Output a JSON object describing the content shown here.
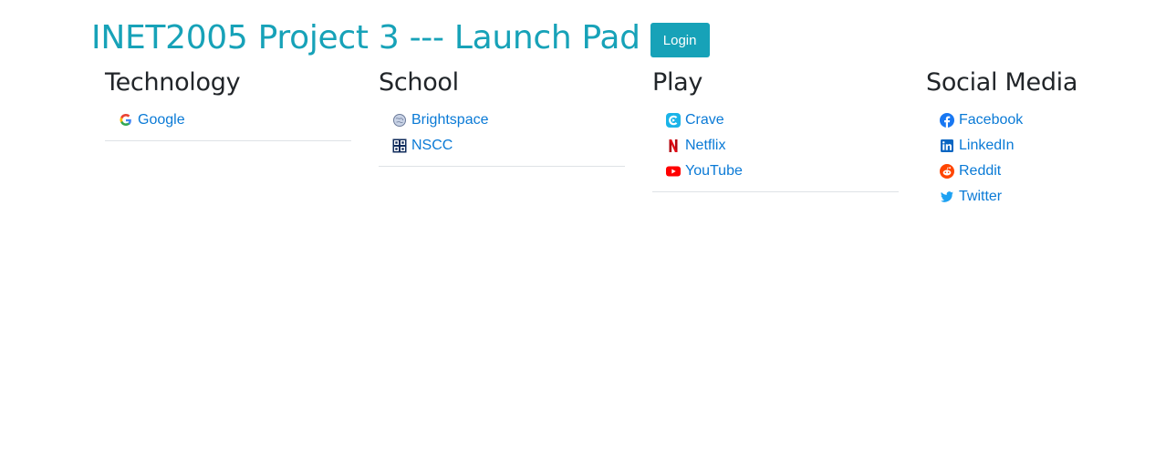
{
  "header": {
    "title": "INET2005 Project 3 --- Launch Pad",
    "login_label": "Login"
  },
  "colors": {
    "accent": "#17a2b8",
    "link": "#0a7ad6",
    "heading": "#212529",
    "divider": "#dee2e6"
  },
  "categories": [
    {
      "title": "Technology",
      "links": [
        {
          "label": "Google",
          "icon": "google-icon"
        }
      ]
    },
    {
      "title": "School",
      "links": [
        {
          "label": "Brightspace",
          "icon": "brightspace-icon"
        },
        {
          "label": "NSCC",
          "icon": "nscc-icon"
        }
      ]
    },
    {
      "title": "Play",
      "links": [
        {
          "label": "Crave",
          "icon": "crave-icon"
        },
        {
          "label": "Netflix",
          "icon": "netflix-icon"
        },
        {
          "label": "YouTube",
          "icon": "youtube-icon"
        }
      ]
    },
    {
      "title": "Social Media",
      "links": [
        {
          "label": "Facebook",
          "icon": "facebook-icon"
        },
        {
          "label": "LinkedIn",
          "icon": "linkedin-icon"
        },
        {
          "label": "Reddit",
          "icon": "reddit-icon"
        },
        {
          "label": "Twitter",
          "icon": "twitter-icon"
        }
      ]
    }
  ]
}
